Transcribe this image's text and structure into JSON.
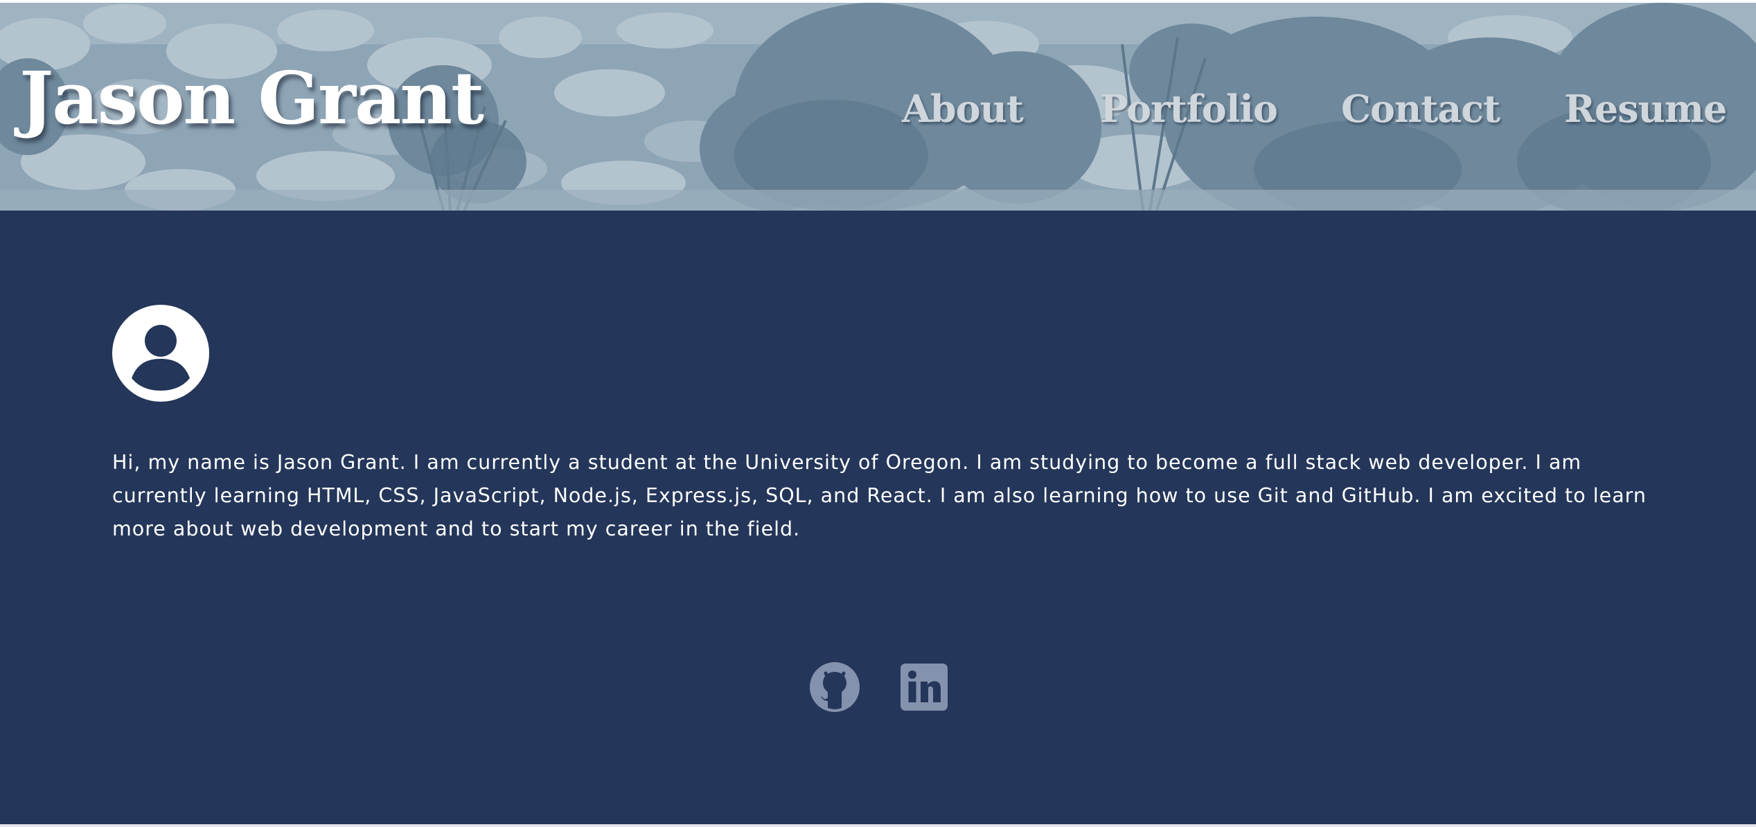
{
  "header": {
    "title": "Jason Grant",
    "nav": [
      {
        "label": "About"
      },
      {
        "label": "Portfolio"
      },
      {
        "label": "Contact"
      },
      {
        "label": "Resume"
      }
    ]
  },
  "main": {
    "avatar_icon": "user-avatar-icon",
    "bio": "Hi, my name is Jason Grant. I am currently a student at the University of Oregon. I am studying to become a full stack web developer. I am currently learning HTML, CSS, JavaScript, Node.js, Express.js, SQL, and React. I am also learning how to use Git and GitHub. I am excited to learn more about web development and to start my career in the field.",
    "social": [
      {
        "icon": "github-icon"
      },
      {
        "icon": "linkedin-icon"
      }
    ]
  },
  "colors": {
    "main_background": "#243659",
    "header_tint": "#8fa6b7",
    "title_text": "#ffffff",
    "nav_text": "#cfd6dc",
    "social_icon": "#8592ad"
  }
}
